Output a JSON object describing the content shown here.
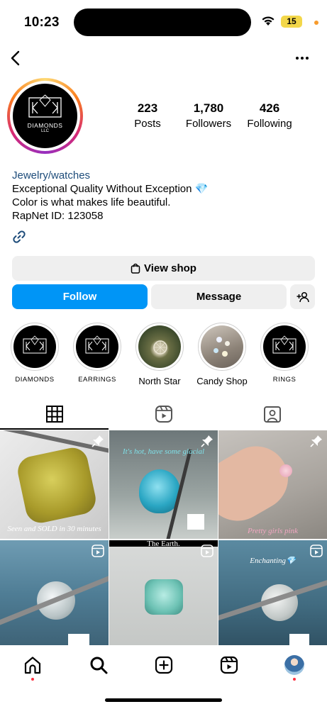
{
  "status": {
    "time": "10:23",
    "battery": "15"
  },
  "profile": {
    "posts": {
      "count": "223",
      "label": "Posts"
    },
    "followers": {
      "count": "1,780",
      "label": "Followers"
    },
    "following": {
      "count": "426",
      "label": "Following"
    },
    "avatar_logo_name": "DIAMONDS",
    "avatar_logo_llc": "LLC"
  },
  "bio": {
    "category": "Jewelry/watches",
    "line1": "Exceptional Quality Without Exception 💎",
    "line2": "Color is what makes life beautiful.",
    "line3": "RapNet ID: 123058"
  },
  "buttons": {
    "view_shop": "View shop",
    "follow": "Follow",
    "message": "Message"
  },
  "highlights": [
    {
      "label": "DIAMONDS"
    },
    {
      "label": "EARRINGS"
    },
    {
      "label": "North Star"
    },
    {
      "label": "Candy Shop"
    },
    {
      "label": "RINGS"
    }
  ],
  "posts": [
    {
      "caption": "Seen and SOLD in 30 minutes",
      "type": "pinned"
    },
    {
      "caption": "It's hot, have some glacial",
      "type": "pinned"
    },
    {
      "caption": "Pretty girls pink",
      "type": "pinned"
    },
    {
      "caption": "",
      "type": "reel"
    },
    {
      "caption": "The Earth.",
      "type": "reel"
    },
    {
      "caption": "Enchanting💎",
      "type": "reel"
    }
  ],
  "colors": {
    "follow": "#0095f6",
    "category": "#1d4c7a",
    "notification": "#ff3040"
  }
}
